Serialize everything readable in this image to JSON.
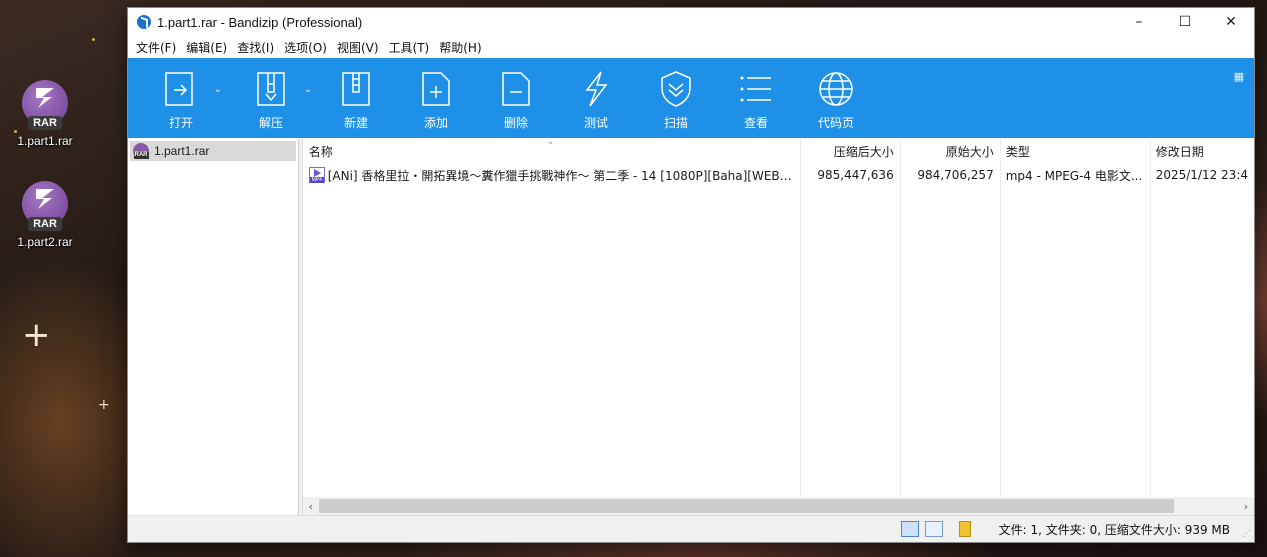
{
  "desktop": {
    "icons": [
      {
        "name": "1.part1.rar",
        "badge": "RAR"
      },
      {
        "name": "1.part2.rar",
        "badge": "RAR"
      }
    ]
  },
  "window": {
    "title": "1.part1.rar - Bandizip (Professional)",
    "controls": {
      "minimize": "–",
      "maximize": "☐",
      "close": "✕"
    }
  },
  "menu": [
    "文件(F)",
    "编辑(E)",
    "查找(I)",
    "选项(O)",
    "视图(V)",
    "工具(T)",
    "帮助(H)"
  ],
  "toolbar": {
    "buttons": [
      {
        "label": "打开",
        "icon": "open-icon"
      },
      {
        "label": "解压",
        "icon": "extract-icon"
      },
      {
        "label": "新建",
        "icon": "new-archive-icon"
      },
      {
        "label": "添加",
        "icon": "add-icon"
      },
      {
        "label": "删除",
        "icon": "delete-icon"
      },
      {
        "label": "测试",
        "icon": "test-icon"
      },
      {
        "label": "扫描",
        "icon": "scan-icon"
      },
      {
        "label": "查看",
        "icon": "view-icon"
      },
      {
        "label": "代码页",
        "icon": "codepage-icon"
      }
    ],
    "accent": "#1e90e8"
  },
  "tree": {
    "selected": "1.part1.rar",
    "badge": "RAR"
  },
  "columns": {
    "name": "名称",
    "packed": "压缩后大小",
    "size": "原始大小",
    "type": "类型",
    "date": "修改日期"
  },
  "files": [
    {
      "name": "[ANi] 香格里拉・開拓異境～糞作獵手挑戰神作～ 第二季 - 14 [1080P][Baha][WEB-D...",
      "packed": "985,447,636",
      "size": "984,706,257",
      "type": "mp4 - MPEG-4 电影文...",
      "date": "2025/1/12 23:4"
    }
  ],
  "status": {
    "text": "文件: 1, 文件夹: 0, 压缩文件大小: 939 MB"
  }
}
